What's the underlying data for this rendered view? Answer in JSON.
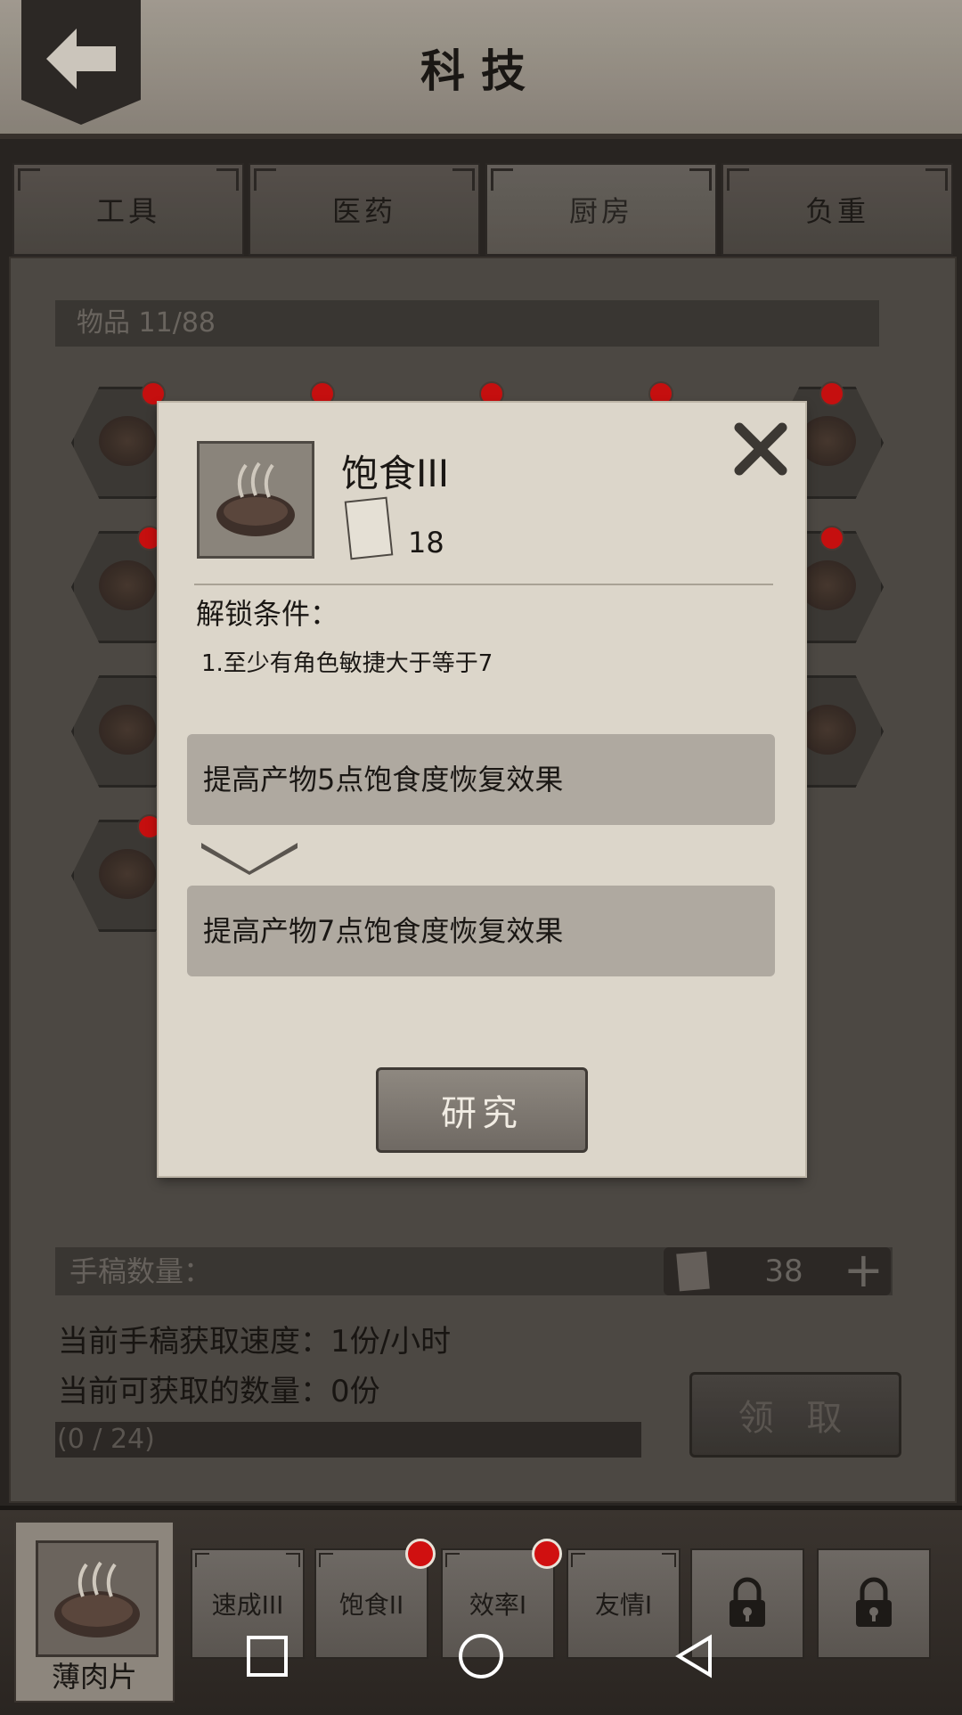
{
  "header": {
    "title": "科技"
  },
  "tabs": [
    {
      "label": "工具"
    },
    {
      "label": "医药"
    },
    {
      "label": "厨房",
      "active": true
    },
    {
      "label": "负重"
    }
  ],
  "items": {
    "label": "物品 11/88"
  },
  "manuscript": {
    "label": "手稿数量：",
    "count": "38",
    "speed": "当前手稿获取速度：1份/小时",
    "available": "当前可获取的数量：0份",
    "progress_text": "(0 / 24)",
    "progress_value": 0,
    "claim": "领 取"
  },
  "dialog": {
    "title": "饱食III",
    "cost": "18",
    "unlock_title": "解锁条件：",
    "condition": "1.至少有角色敏捷大于等于7",
    "effect_current": "提高产物5点饱食度恢复效果",
    "effect_next": "提高产物7点饱食度恢复效果",
    "research": "研究"
  },
  "bottom": {
    "selected": "薄肉片",
    "techs": [
      {
        "label": "速成III",
        "dot": false
      },
      {
        "label": "饱食II",
        "dot": true
      },
      {
        "label": "效率I",
        "dot": true
      },
      {
        "label": "友情I",
        "dot": false
      },
      {
        "label": "",
        "locked": true
      },
      {
        "label": "",
        "locked": true
      }
    ]
  },
  "colors": {
    "notification": "#d01010",
    "dialog": "#dcd6ca",
    "panel": "#514c47"
  }
}
